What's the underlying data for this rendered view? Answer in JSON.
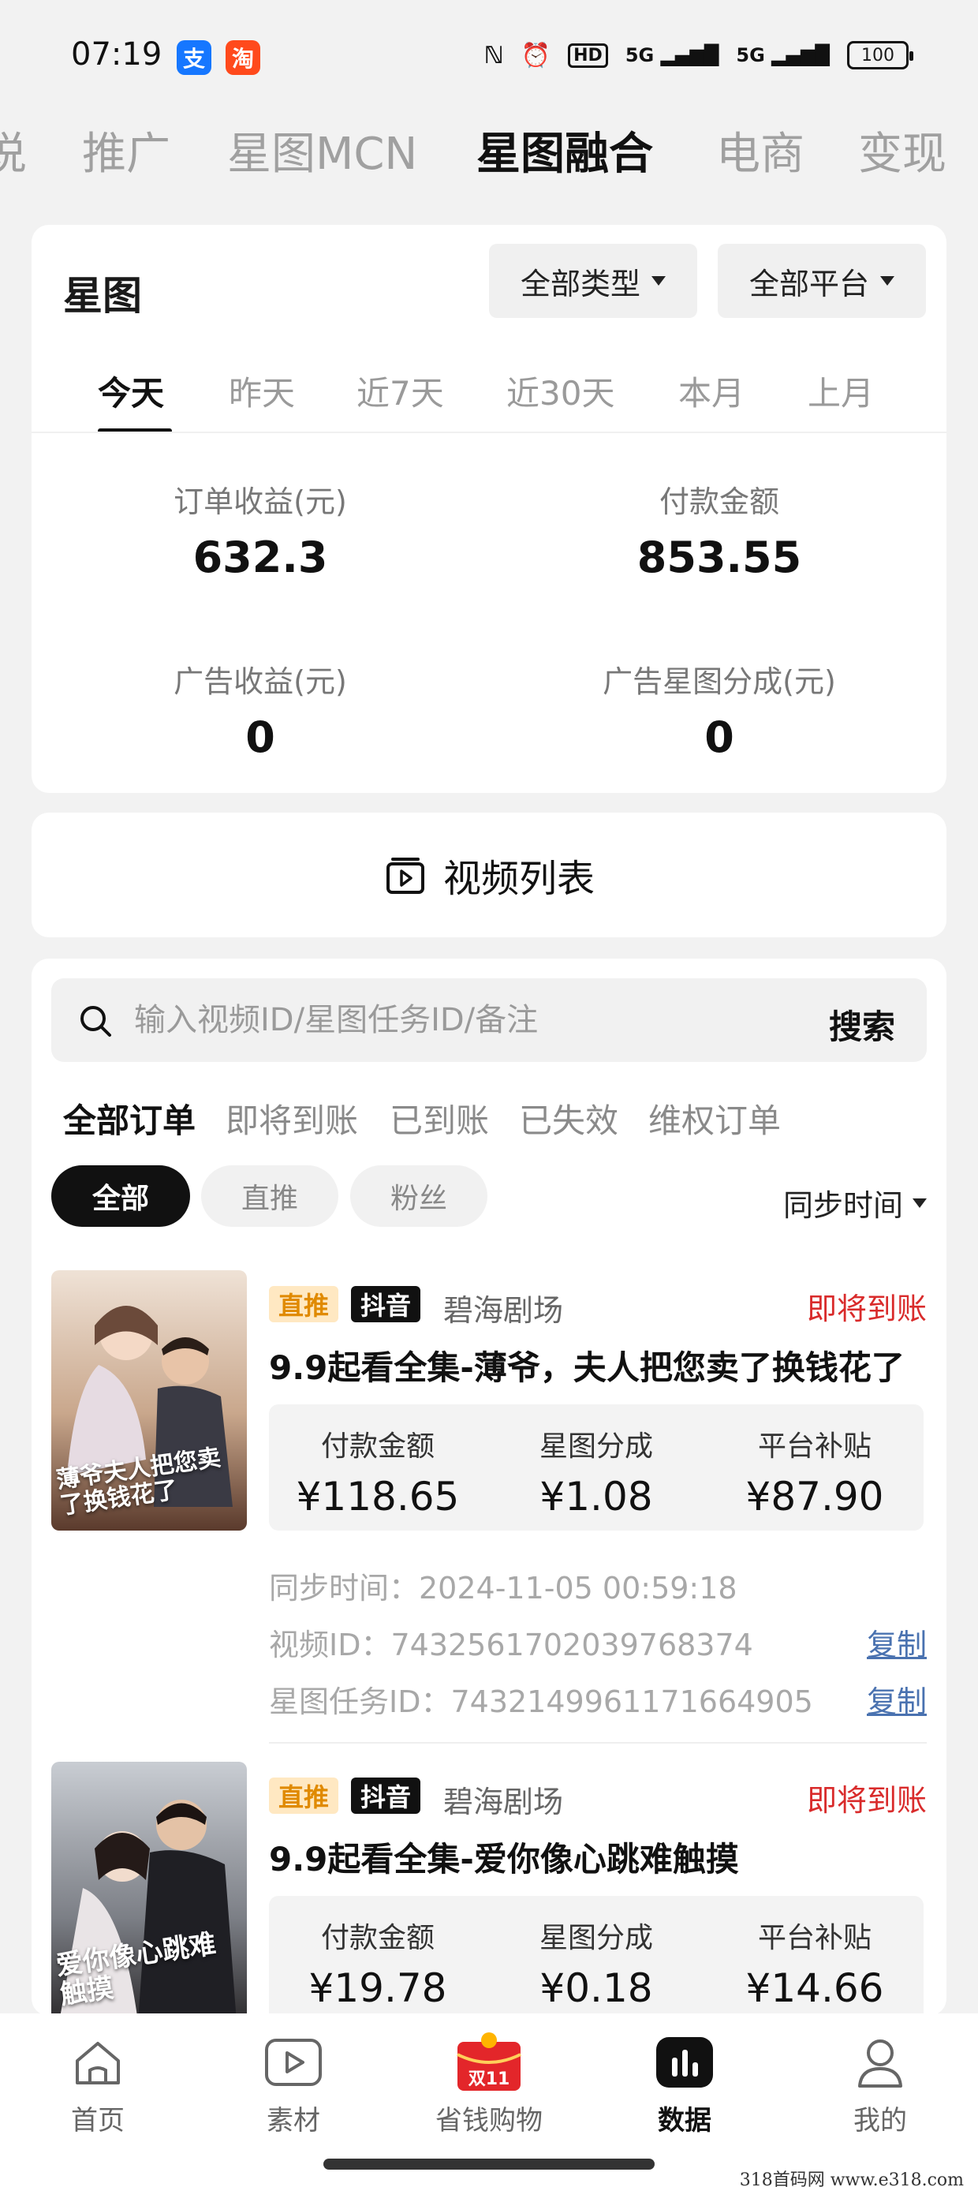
{
  "status_bar": {
    "time": "07:19",
    "apps": [
      {
        "label": "支",
        "color": "#1677ff"
      },
      {
        "label": "淘",
        "color": "#ff4a1c"
      }
    ],
    "icons": [
      "nfc-icon",
      "alarm-icon",
      "hd-icon",
      "5g-signal-icon",
      "5g-signal-icon"
    ],
    "hd_label": "HD",
    "signal_1": "5G",
    "signal_2": "5G",
    "battery": "100"
  },
  "top_tabs": {
    "items": [
      "说",
      "推广",
      "星图MCN",
      "星图融合",
      "电商",
      "变现"
    ],
    "active_index": 3
  },
  "stats": {
    "title": "星图",
    "type_filter": "全部类型",
    "platform_filter": "全部平台",
    "date_tabs": [
      "今天",
      "昨天",
      "近7天",
      "近30天",
      "本月",
      "上月"
    ],
    "active_date_index": 0,
    "order_income_label": "订单收益(元)",
    "order_income_value": "632.3",
    "payment_amount_label": "付款金额",
    "payment_amount_value": "853.55",
    "ad_income_label": "广告收益(元)",
    "ad_income_value": "0",
    "ad_share_label": "广告星图分成(元)",
    "ad_share_value": "0"
  },
  "video_list": {
    "label": "视频列表"
  },
  "search": {
    "placeholder": "输入视频ID/星图任务ID/备注",
    "button": "搜索"
  },
  "order_tabs": {
    "items": [
      "全部订单",
      "即将到账",
      "已到账",
      "已失效",
      "维权订单"
    ],
    "active_index": 0
  },
  "pills": {
    "items": [
      "全部",
      "直推",
      "粉丝"
    ],
    "active_index": 0
  },
  "sort": {
    "label": "同步时间"
  },
  "orders": [
    {
      "tag_direct": "直推",
      "tag_platform": "抖音",
      "shop": "碧海剧场",
      "status": "即将到账",
      "title": "9.9起看全集-薄爷，夫人把您卖了换钱花了",
      "thumb_text": "薄爷夫人把您卖了换钱花了",
      "payment_label": "付款金额",
      "payment_value": "¥118.65",
      "share_label": "星图分成",
      "share_value": "¥1.08",
      "subsidy_label": "平台补贴",
      "subsidy_value": "¥87.90",
      "sync_time": "同步时间：2024-11-05 00:59:18",
      "video_id": "视频ID：7432561702039768374",
      "task_id": "星图任务ID：7432149961171664905",
      "copy_label": "复制"
    },
    {
      "tag_direct": "直推",
      "tag_platform": "抖音",
      "shop": "碧海剧场",
      "status": "即将到账",
      "title": "9.9起看全集-爱你像心跳难触摸",
      "thumb_text": "爱你像心跳难触摸",
      "payment_label": "付款金额",
      "payment_value": "¥19.78",
      "share_label": "星图分成",
      "share_value": "¥0.18",
      "subsidy_label": "平台补贴",
      "subsidy_value": "¥14.66"
    }
  ],
  "bottom_nav": {
    "items": [
      {
        "label": "首页",
        "icon": "home-icon"
      },
      {
        "label": "素材",
        "icon": "play-icon"
      },
      {
        "label": "省钱购物",
        "icon": "double11-icon",
        "badge": "双11"
      },
      {
        "label": "数据",
        "icon": "chart-icon"
      },
      {
        "label": "我的",
        "icon": "user-icon"
      }
    ],
    "active_index": 3
  },
  "watermark": "318首码网  www.e318.com"
}
